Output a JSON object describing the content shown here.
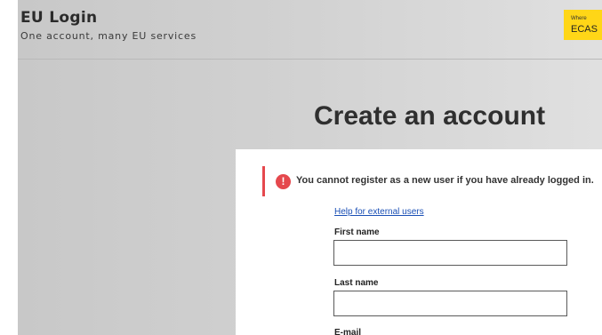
{
  "header": {
    "title": "EU Login",
    "subtitle": "One account, many EU services",
    "badge_small": "Where",
    "badge_big": "ECAS"
  },
  "main": {
    "page_title": "Create an account",
    "alert": {
      "icon": "!",
      "message": "You cannot register as a new user if you have already logged in."
    },
    "help_link": "Help for external users",
    "fields": {
      "first_name": {
        "label": "First name",
        "value": "",
        "placeholder": ""
      },
      "last_name": {
        "label": "Last name",
        "value": "",
        "placeholder": ""
      },
      "email": {
        "label": "E-mail"
      }
    }
  },
  "colors": {
    "alert_red": "#e5484d",
    "badge_yellow": "#ffd617",
    "link_blue": "#1a4fb5"
  }
}
